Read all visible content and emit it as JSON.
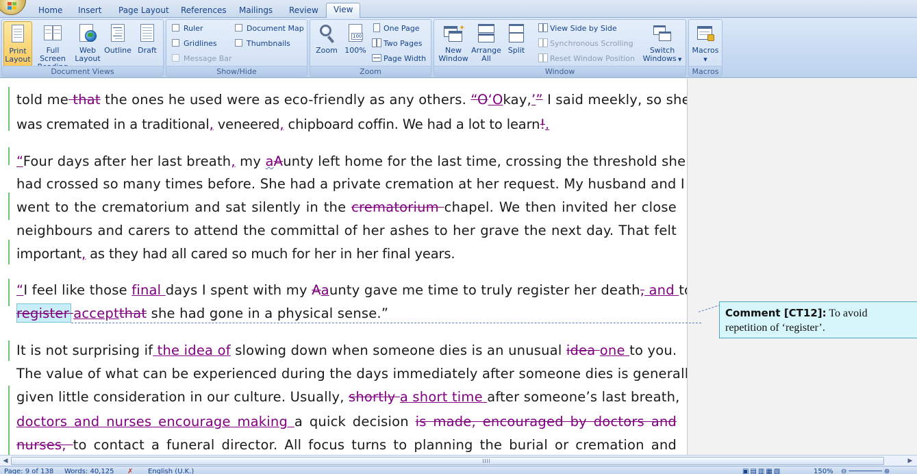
{
  "tabs": [
    {
      "label": "Home",
      "active": false
    },
    {
      "label": "Insert",
      "active": false
    },
    {
      "label": "Page Layout",
      "active": false
    },
    {
      "label": "References",
      "active": false
    },
    {
      "label": "Mailings",
      "active": false
    },
    {
      "label": "Review",
      "active": false
    },
    {
      "label": "View",
      "active": true
    }
  ],
  "ribbon": {
    "document_views": {
      "label": "Document Views",
      "print_layout": "Print Layout",
      "print_layout_l1": "Print",
      "print_layout_l2": "Layout",
      "full_screen_l1": "Full Screen",
      "full_screen_l2": "Reading",
      "web_l1": "Web",
      "web_l2": "Layout",
      "outline": "Outline",
      "draft": "Draft"
    },
    "show_hide": {
      "label": "Show/Hide",
      "ruler": "Ruler",
      "gridlines": "Gridlines",
      "message_bar": "Message Bar",
      "document_map": "Document Map",
      "thumbnails": "Thumbnails"
    },
    "zoom": {
      "label": "Zoom",
      "zoom": "Zoom",
      "hundred": "100%",
      "hundred_icon": "100",
      "one_page": "One Page",
      "two_pages": "Two Pages",
      "page_width": "Page Width"
    },
    "window": {
      "label": "Window",
      "new_l1": "New",
      "new_l2": "Window",
      "arrange_l1": "Arrange",
      "arrange_l2": "All",
      "split": "Split",
      "side_by_side": "View Side by Side",
      "sync_scrolling": "Synchronous Scrolling",
      "reset_position": "Reset Window Position",
      "switch_l1": "Switch",
      "switch_l2": "Windows"
    },
    "macros": {
      "label": "Macros",
      "macros": "Macros"
    }
  },
  "document": {
    "p1": {
      "l1_a": "told me",
      "l1_del1": " that",
      "l1_b": " the ones he used were as eco-friendly as any others. ",
      "l1_del2": "“O",
      "l1_ins1": "‘O",
      "l1_c": "kay,",
      "l1_ins2": "’",
      "l1_del3": "”",
      "l1_d": " I said meekly, so she",
      "l2_a": "was cremated in a traditional",
      "l2_ins1": ",",
      "l2_b": " veneered",
      "l2_ins2": ",",
      "l2_c": " chipboard coffin. We had a lot to learn",
      "l2_del1": "!",
      "l2_ins3": "."
    },
    "p2": {
      "l1_ins1": "“",
      "l1_a": "Four days after her last breath",
      "l1_ins2": ",",
      "l1_b": " my ",
      "l1_ins3": "a",
      "l1_del1": "A",
      "l1_c": "unty left home for the last time, crossing the threshold she",
      "l2": "had crossed so many times before. She had a private cremation at her request. My husband and I",
      "l3_a": "went to the crematorium and sat silently in the ",
      "l3_del1": "crematorium ",
      "l3_b": "chapel. We then invited her close",
      "l4": "neighbours and carers to attend the committal of her ashes to her grave the next day. That felt",
      "l5_a": "important",
      "l5_ins1": ",",
      "l5_b": " as they had all cared so much for her in her final years."
    },
    "p3": {
      "l1_ins1": "“",
      "l1_a": "I feel like those ",
      "l1_ins2": "final ",
      "l1_b": "days I spent with my ",
      "l1_del1": "A",
      "l1_ins3": "a",
      "l1_c": "unty gave me time to truly register her death",
      "l1_del2": ",",
      "l1_ins4": " and ",
      "l1_d": "to",
      "l2_del1": "register ",
      "l2_ins1": "accept",
      "l2_del2": "that",
      "l2_a": " she had gone in a physical sense.”"
    },
    "p4": {
      "l1_a": "It is not surprising if",
      "l1_ins1": " the idea of",
      "l1_b": " slowing down when someone dies is an unusual ",
      "l1_del1": "idea ",
      "l1_ins2": "one ",
      "l1_c": "to you.",
      "l2": "The value of what can be experienced during the days immediately after someone dies is generally",
      "l3_a": "given little consideration in our culture. Usually, ",
      "l3_del1": "shortly ",
      "l3_ins1": "a short time ",
      "l3_b": "after someone’s last breath,",
      "l4_ins1": "doctors and nurses encourage making ",
      "l4_a": "a quick decision ",
      "l4_del1": "is made, encouraged by doctors and",
      "l5_del1": "nurses, ",
      "l5_a": "to contact a funeral director. All focus turns to planning the burial or cremation and"
    }
  },
  "comment": {
    "title": "Comment [CT12]:",
    "text": " To avoid repetition of ‘register’."
  },
  "status": {
    "page": "Page: 9 of 138",
    "words": "Words: 40,125",
    "language": "English (U.K.)",
    "zoom": "150%"
  },
  "colors": {
    "revision": "#800080",
    "change_bar": "#6fc26f",
    "comment_bg": "#d7f6fb"
  }
}
